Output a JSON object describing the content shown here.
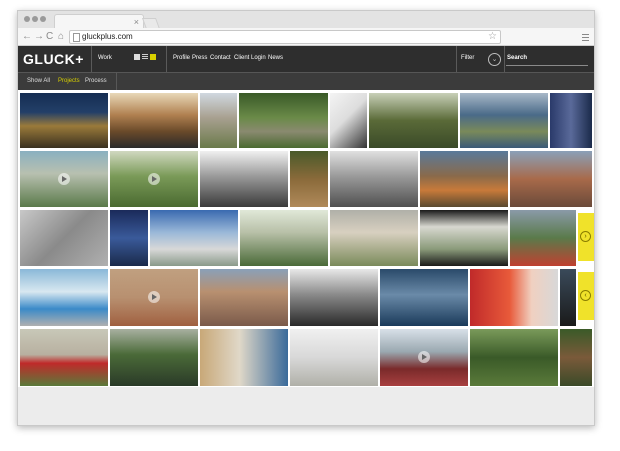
{
  "browser": {
    "url": "gluckplus.com",
    "tab_close": "×",
    "back": "←",
    "forward": "→",
    "reload": "C",
    "home": "⌂",
    "star": "☆"
  },
  "site": {
    "logo": "GLUCK+",
    "work_label": "Work",
    "nav": [
      "Profile",
      "Press",
      "Contact",
      "Client Login",
      "News"
    ],
    "filter_label": "Filter",
    "filter_icon": "⌄",
    "search_label": "Search"
  },
  "subnav": {
    "items": [
      "Show All",
      "Projects",
      "Process"
    ],
    "active_index": 1
  },
  "pager": {
    "next": "›",
    "prev": "‹"
  },
  "colors": {
    "accent": "#d8d000",
    "header_bg": "#2e2e2e",
    "subnav_bg": "#3b3b3b",
    "pager_bg": "#f0e22a"
  }
}
